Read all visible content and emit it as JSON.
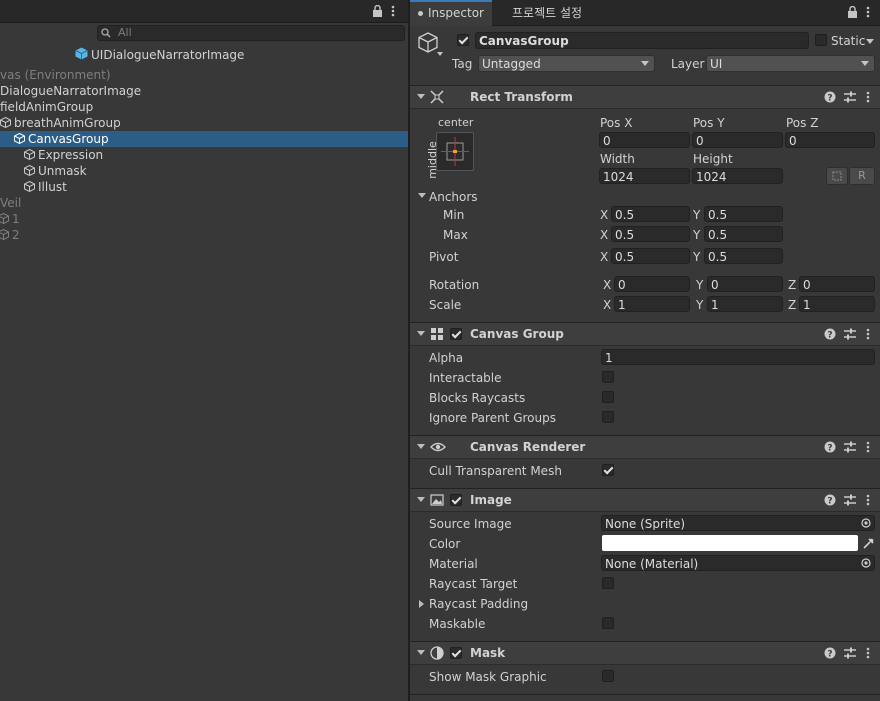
{
  "hierarchy": {
    "search_placeholder": "All",
    "scene_title": "UIDialogueNarratorImage",
    "rows": [
      {
        "label": "vas (Environment)",
        "dim": true
      },
      {
        "label": "DialogueNarratorImage"
      },
      {
        "label": "fieldAnimGroup"
      },
      {
        "label": "breathAnimGroup"
      },
      {
        "label": "CanvasGroup",
        "selected": true
      },
      {
        "label": "Expression"
      },
      {
        "label": "Unmask"
      },
      {
        "label": "Illust"
      },
      {
        "label": "Veil",
        "dim": true
      },
      {
        "label": "1",
        "dim": true
      },
      {
        "label": "2",
        "dim": true
      }
    ]
  },
  "inspector": {
    "tabs": [
      "Inspector",
      "프로젝트 설정"
    ],
    "object_name": "CanvasGroup",
    "static_label": "Static",
    "tag_label": "Tag",
    "tag_value": "Untagged",
    "layer_label": "Layer",
    "layer_value": "UI",
    "rect": {
      "title": "Rect Transform",
      "anchor_h": "center",
      "anchor_v": "middle",
      "pos_x_label": "Pos X",
      "pos_y_label": "Pos Y",
      "pos_z_label": "Pos Z",
      "pos_x": "0",
      "pos_y": "0",
      "pos_z": "0",
      "width_label": "Width",
      "height_label": "Height",
      "width": "1024",
      "height": "1024",
      "r_button": "R",
      "anchors_label": "Anchors",
      "min_label": "Min",
      "max_label": "Max",
      "min_x": "0.5",
      "min_y": "0.5",
      "max_x": "0.5",
      "max_y": "0.5",
      "pivot_label": "Pivot",
      "pivot_x": "0.5",
      "pivot_y": "0.5",
      "rotation_label": "Rotation",
      "rot_x": "0",
      "rot_y": "0",
      "rot_z": "0",
      "scale_label": "Scale",
      "scale_x": "1",
      "scale_y": "1",
      "scale_z": "1",
      "x": "X",
      "y": "Y",
      "z": "Z"
    },
    "canvas_group": {
      "title": "Canvas Group",
      "alpha_label": "Alpha",
      "alpha": "1",
      "interactable_label": "Interactable",
      "blocks_label": "Blocks Raycasts",
      "ignore_label": "Ignore Parent Groups"
    },
    "canvas_renderer": {
      "title": "Canvas Renderer",
      "cull_label": "Cull Transparent Mesh"
    },
    "image": {
      "title": "Image",
      "source_label": "Source Image",
      "source_value": "None (Sprite)",
      "color_label": "Color",
      "color_value": "#ffffff",
      "material_label": "Material",
      "material_value": "None (Material)",
      "raycast_target_label": "Raycast Target",
      "raycast_padding_label": "Raycast Padding",
      "maskable_label": "Maskable"
    },
    "mask": {
      "title": "Mask",
      "show_label": "Show Mask Graphic"
    }
  },
  "colors": {
    "accent": "#3a79bb",
    "selection": "#2c5d87",
    "cube": "#5ab4e6"
  }
}
